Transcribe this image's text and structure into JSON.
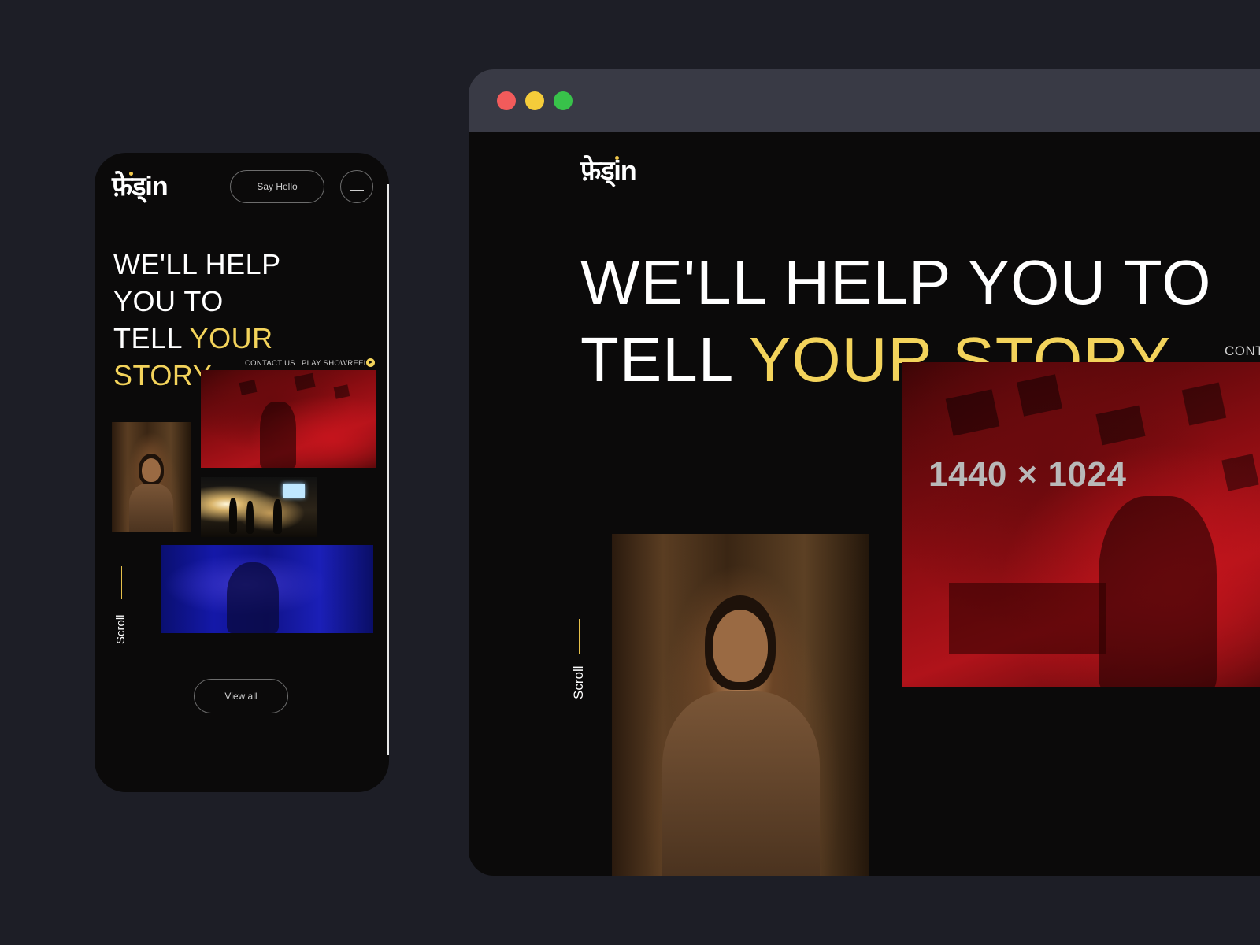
{
  "colors": {
    "background": "#1d1e26",
    "accent_yellow": "#f3d35b",
    "traffic_red": "#f25b5b",
    "traffic_yellow": "#f5cc3a",
    "traffic_green": "#38c24a"
  },
  "mobile": {
    "logo": "फ़ेड्in",
    "say_hello": "Say Hello",
    "menu_icon": "hamburger-icon",
    "headline": {
      "line1": "WE'LL HELP",
      "line2": "YOU TO",
      "line3_white": "TELL ",
      "line3_yellow": "YOUR",
      "line4_yellow": "STORY"
    },
    "contact_us": "CONTACT US",
    "play_showreel": "PLAY SHOWREEL",
    "play_icon": "play-icon",
    "scroll": "Scroll",
    "view_all": "View all"
  },
  "desktop": {
    "logo": "फ़ेड्in",
    "headline": {
      "line1": "WE'LL HELP YOU TO",
      "line2_white": "TELL ",
      "line2_yellow": "YOUR STORY"
    },
    "resolution": "1440 × 1024",
    "contact_partial": "CONT",
    "scroll": "Scroll"
  }
}
